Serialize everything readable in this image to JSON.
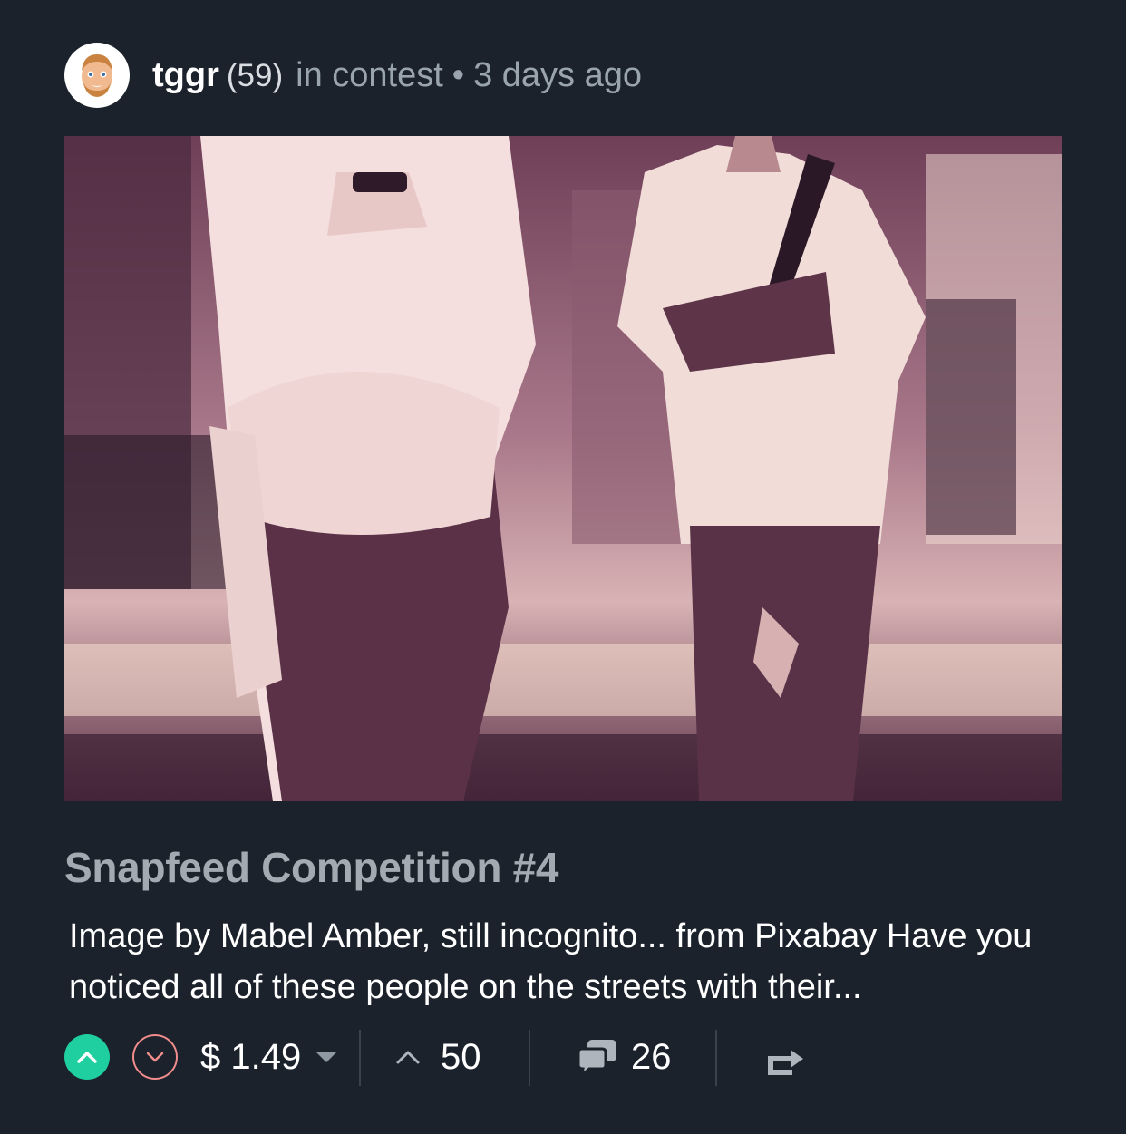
{
  "post": {
    "author": "tggr",
    "reputation": "(59)",
    "category": "in contest",
    "separator": "•",
    "time": "3 days ago",
    "title": "Snapfeed Competition #4",
    "excerpt": "Image by Mabel Amber, still incognito... from Pixabay Have you noticed all of these people on the streets with their..."
  },
  "footer": {
    "payout": "$ 1.49",
    "votes": "50",
    "comments": "26"
  },
  "colors": {
    "background": "#1b222b",
    "upvote": "#1fcfa0",
    "downvote": "#f08c8c",
    "title": "#a3aab1",
    "photo_tint": "#c99aa6"
  },
  "icons": [
    "avatar",
    "upvote-icon",
    "downvote-icon",
    "dropdown-caret-icon",
    "upvote-count-icon",
    "comments-icon",
    "reblog-icon"
  ]
}
